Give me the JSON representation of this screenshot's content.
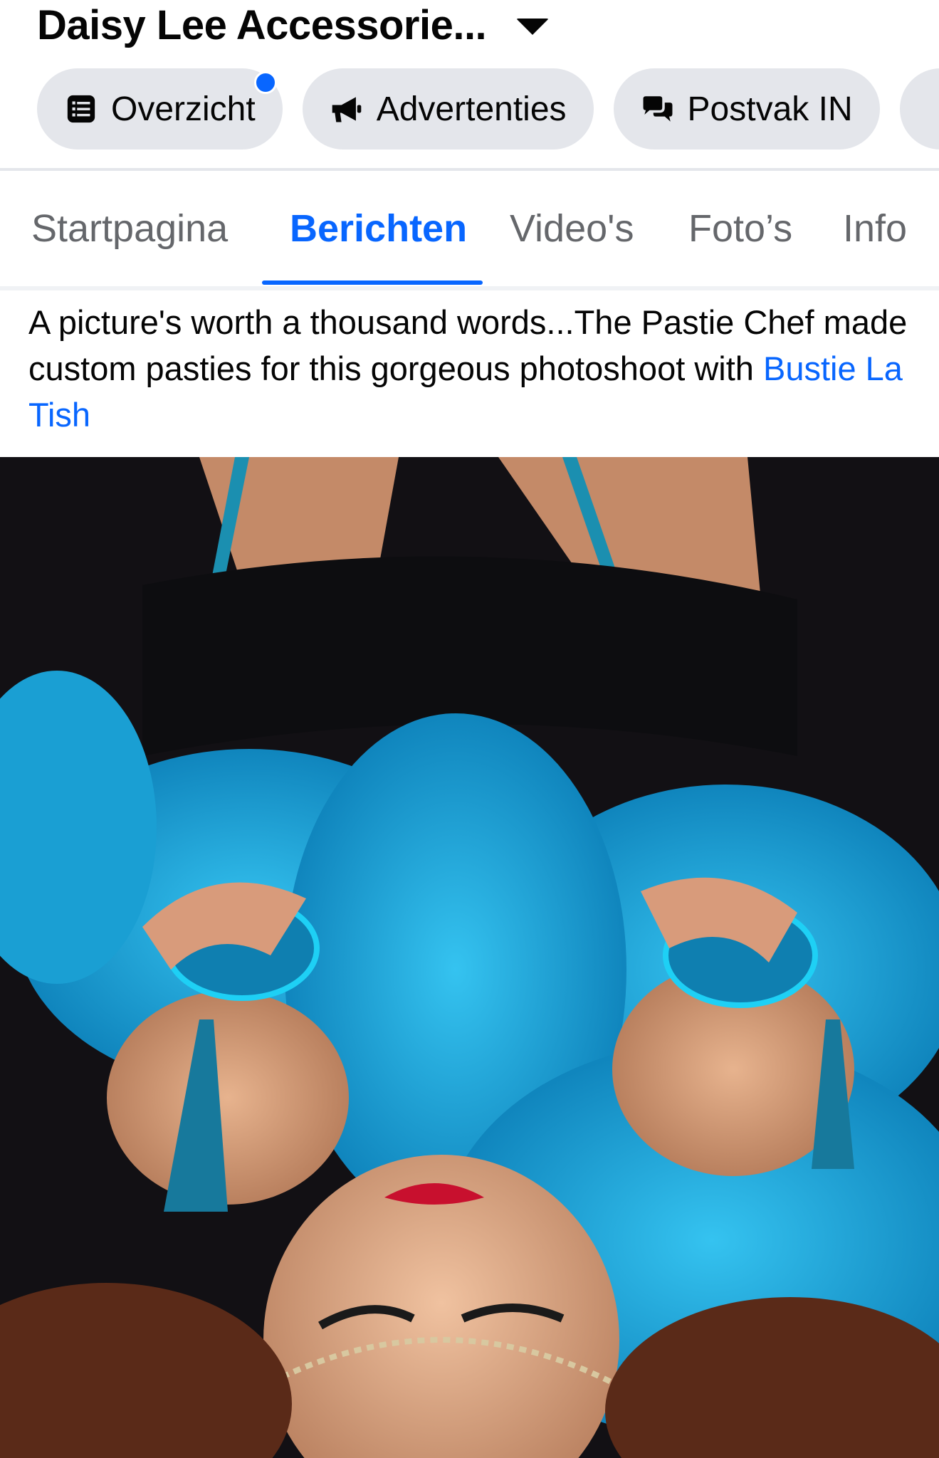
{
  "header": {
    "page_name": "Daisy Lee Accessorie...",
    "chips": [
      {
        "label": "Overzicht",
        "icon": "list-icon",
        "has_notification_dot": true
      },
      {
        "label": "Advertenties",
        "icon": "megaphone-icon"
      },
      {
        "label": "Postvak IN",
        "icon": "chat-bubbles-icon"
      }
    ]
  },
  "tabs": {
    "items": [
      "Startpagina",
      "Berichten",
      "Video's",
      "Foto’s",
      "Info"
    ],
    "active": "Berichten"
  },
  "post": {
    "text_before_mention": "A picture's worth a thousand words...The Pastie Chef made custom pasties for this gorgeous photoshoot with ",
    "mention": "Bustie La Tish"
  },
  "colors": {
    "accent_blue": "#0866ff",
    "chip_bg": "#e4e6eb",
    "secondary_text": "#65676b",
    "feather_blue": "#1aa6d9"
  }
}
